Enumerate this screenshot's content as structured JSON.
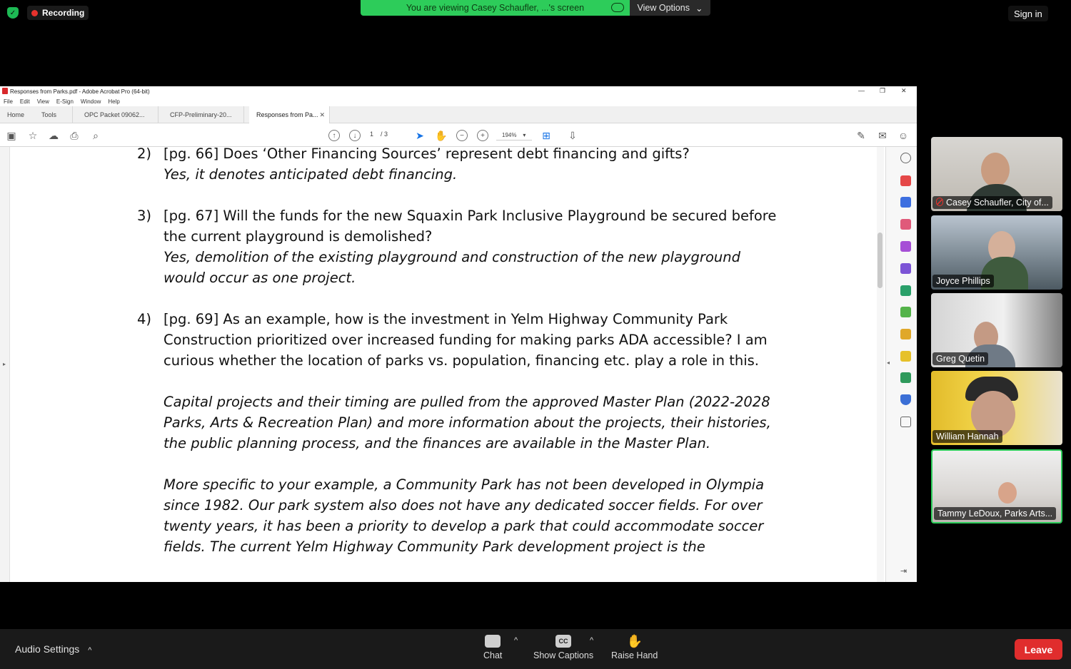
{
  "zoom": {
    "recording_label": "Recording",
    "viewing_label": "You are viewing Casey Schaufler, ...'s screen",
    "view_options_label": "View Options",
    "sign_in_label": "Sign in",
    "audio_settings_label": "Audio Settings",
    "chat_label": "Chat",
    "captions_label": "Show Captions",
    "captions_icon_text": "CC",
    "raise_hand_label": "Raise Hand",
    "leave_label": "Leave"
  },
  "acrobat": {
    "window_title": "Responses from Parks.pdf - Adobe Acrobat Pro (64-bit)",
    "menu": [
      "File",
      "Edit",
      "View",
      "E-Sign",
      "Window",
      "Help"
    ],
    "tabs": [
      "Home",
      "Tools",
      "OPC Packet 09062...",
      "CFP-Preliminary-20...",
      "Responses from Pa..."
    ],
    "page_current": "1",
    "page_total": "/ 3",
    "zoom_level": "194%"
  },
  "document": {
    "items": [
      {
        "number": "2)",
        "question": [
          "[pg. 66] Does ‘Other Financing Sources’ represent debt financing and gifts?"
        ],
        "answer": [
          "Yes, it denotes anticipated debt financing."
        ]
      },
      {
        "number": "3)",
        "question": [
          "[pg. 67] Will the funds for the new Squaxin Park Inclusive Playground be secured before",
          "the current playground is demolished?"
        ],
        "answer": [
          "Yes, demolition of the existing playground and construction of the new playground",
          "would occur as one project."
        ]
      },
      {
        "number": "4)",
        "question": [
          "[pg. 69] As an example, how is the investment in Yelm Highway Community Park",
          "Construction prioritized over increased funding for making parks ADA accessible? I am",
          "curious whether the location of parks vs. population, financing etc. play a role in this."
        ],
        "answer": [
          "Capital projects and their timing are pulled from the approved Master Plan (2022-2028",
          "Parks, Arts & Recreation Plan) and more information about the projects, their histories,",
          "the public planning process, and the finances are available in the Master Plan."
        ],
        "answer2": [
          "More specific to your example, a Community Park has not been developed in Olympia",
          "since 1982. Our park system also does not have any dedicated soccer fields. For over",
          "twenty years, it has been a priority to develop a park that could accommodate soccer",
          "fields. The current Yelm Highway Community Park development project is the"
        ]
      }
    ]
  },
  "participants": [
    {
      "name": "Casey Schaufler, City of...",
      "muted": true
    },
    {
      "name": "Joyce Phillips",
      "muted": false
    },
    {
      "name": "Greg Quetin",
      "muted": false
    },
    {
      "name": "William Hannah",
      "muted": false
    },
    {
      "name": "Tammy LeDoux, Parks Arts...",
      "muted": false,
      "active_speaker": true
    }
  ],
  "colors": {
    "zoom_green": "#2dcc5a",
    "leave_red": "#e02d2d",
    "recording_red": "#e8322d"
  }
}
